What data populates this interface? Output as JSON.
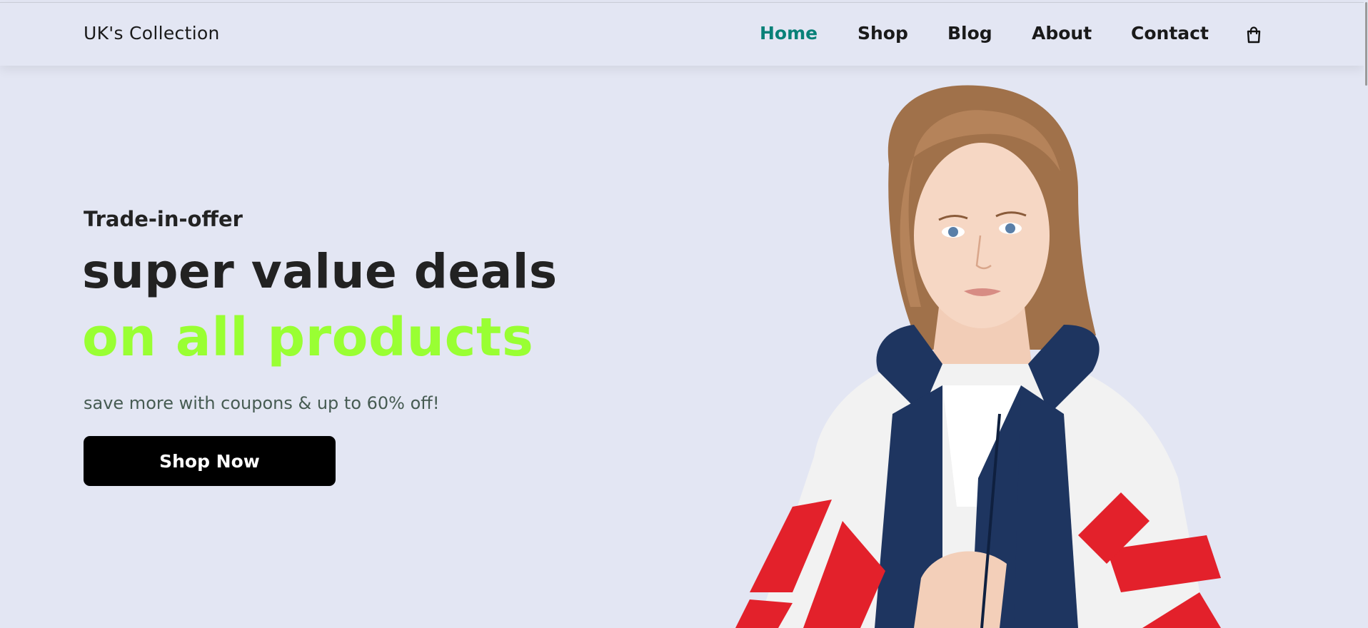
{
  "header": {
    "logo_text": "UK's Collection",
    "nav": [
      {
        "label": "Home",
        "active": true
      },
      {
        "label": "Shop",
        "active": false
      },
      {
        "label": "Blog",
        "active": false
      },
      {
        "label": "About",
        "active": false
      },
      {
        "label": "Contact",
        "active": false
      }
    ],
    "cart_icon": "shopping-bag-icon",
    "active_color": "#088178"
  },
  "hero": {
    "kicker": "Trade-in-offer",
    "title_line1": "super value deals",
    "title_line2": "on all products",
    "subtitle": "save more with coupons & up to 60% off!",
    "button_label": "Shop Now",
    "title_line2_color": "#99ff33",
    "background_color": "#e3e6f3"
  }
}
